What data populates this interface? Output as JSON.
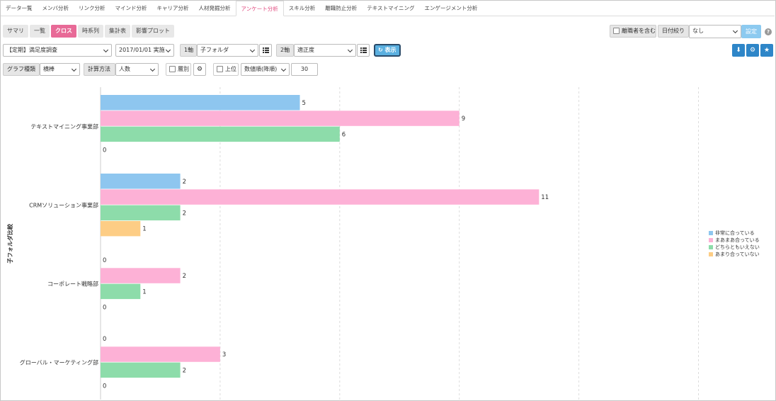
{
  "nav": {
    "tabs": [
      {
        "label": "データ一覧",
        "active": false
      },
      {
        "label": "メンバ分析",
        "active": false
      },
      {
        "label": "リンク分析",
        "active": false
      },
      {
        "label": "マインド分析",
        "active": false
      },
      {
        "label": "キャリア分析",
        "active": false
      },
      {
        "label": "人材発掘分析",
        "active": false
      },
      {
        "label": "アンケート分析",
        "active": true
      },
      {
        "label": "スキル分析",
        "active": false
      },
      {
        "label": "離職防止分析",
        "active": false
      },
      {
        "label": "テキストマイニング",
        "active": false
      },
      {
        "label": "エンゲージメント分析",
        "active": false
      }
    ]
  },
  "subtabs": [
    {
      "label": "サマリ",
      "active": false
    },
    {
      "label": "一覧",
      "active": false
    },
    {
      "label": "クロス",
      "active": true
    },
    {
      "label": "時系列",
      "active": false
    },
    {
      "label": "集計表",
      "active": false
    },
    {
      "label": "影響プロット",
      "active": false
    }
  ],
  "filters": {
    "include_retired_label": "離職者を含む",
    "date_filter_label": "日付絞り",
    "date_filter_value": "なし",
    "setting_label": "設定",
    "help": "?"
  },
  "controls": {
    "survey": "【定期】満足度調査",
    "period": "2017/01/01 実施",
    "axis1_label": "1軸",
    "axis1_value": "子フォルダ",
    "axis2_label": "2軸",
    "axis2_value": "適正度",
    "show_label": "表示",
    "graph_type_label": "グラフ種類",
    "graph_type_value": "横棒",
    "calc_label": "計算方法",
    "calc_value": "人数",
    "layer_label": "層別",
    "top_label": "上位",
    "sort_value": "数値順(降順)",
    "top_count": "30"
  },
  "icons": {
    "download": "download-icon",
    "settings": "gear-icon",
    "favorite": "star-icon",
    "list": "list-icon",
    "refresh": "refresh-icon"
  },
  "chart_data": {
    "type": "bar",
    "orientation": "horizontal",
    "ylabel": "子フォルダ比較",
    "categories": [
      "テキストマイニング事業部",
      "CRMソリューション事業部",
      "コーポレート戦略部",
      "グローバル・マーケティング部"
    ],
    "series": [
      {
        "name": "非常に合っている",
        "color": "#8ec6ef",
        "values": [
          5,
          2,
          0,
          0
        ]
      },
      {
        "name": "まあまあ合っている",
        "color": "#fdb1d6",
        "values": [
          9,
          11,
          2,
          3
        ]
      },
      {
        "name": "どちらともいえない",
        "color": "#8ddcaa",
        "values": [
          6,
          2,
          1,
          2
        ]
      },
      {
        "name": "あまり合っていない",
        "color": "#fdcd85",
        "values": [
          0,
          1,
          0,
          0
        ]
      }
    ],
    "xlim": [
      0,
      15
    ],
    "grid": true,
    "legend_position": "right"
  }
}
